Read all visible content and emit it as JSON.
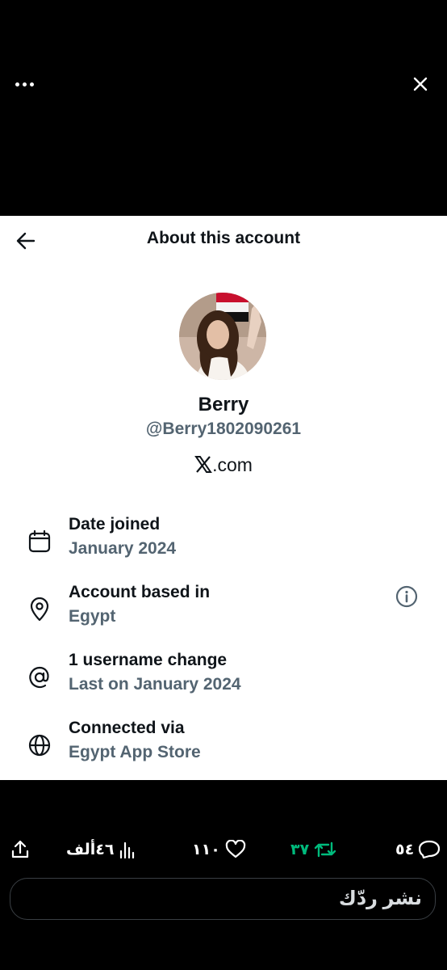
{
  "header": {
    "more_icon": "more-horizontal-icon",
    "close_icon": "close-icon"
  },
  "sheet": {
    "title": "About this account",
    "back_icon": "arrow-left-icon"
  },
  "profile": {
    "name": "Berry",
    "handle": "@Berry1802090261",
    "site_domain": ".com",
    "site_logo": "x-logo-icon"
  },
  "details": [
    {
      "icon": "calendar-icon",
      "label": "Date joined",
      "value": "January 2024"
    },
    {
      "icon": "location-pin-icon",
      "label": "Account based in",
      "value": "Egypt",
      "extra_icon": "info-icon"
    },
    {
      "icon": "at-sign-icon",
      "label": "1 username change",
      "value": "Last on January 2024"
    },
    {
      "icon": "globe-icon",
      "label": "Connected via",
      "value": "Egypt App Store"
    }
  ],
  "actions": {
    "share_icon": "share-icon",
    "views": "٤٦ألف",
    "likes": "١١٠",
    "reposts": "٣٧",
    "replies": "٥٤",
    "repost_color": "#00ba7c"
  },
  "reply": {
    "placeholder": "نشر ردّك"
  },
  "colors": {
    "primary_text": "#0f1419",
    "secondary_text": "#536471",
    "background_dark": "#000000",
    "sheet_background": "#ffffff"
  }
}
